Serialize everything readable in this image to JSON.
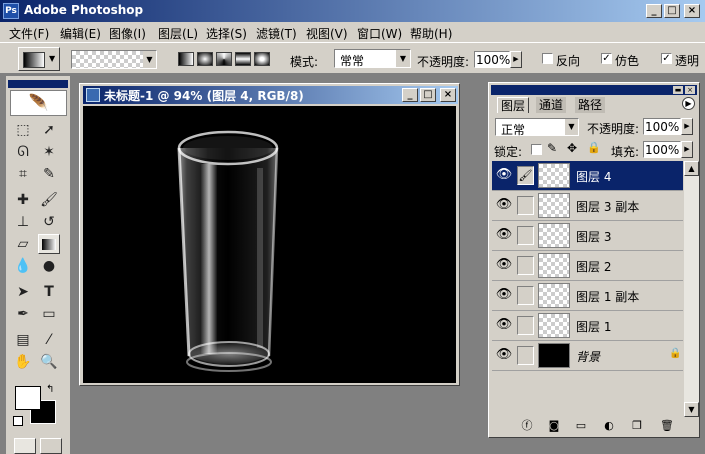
{
  "app": {
    "title": "Adobe Photoshop",
    "icon": "photoshop-logo-icon"
  },
  "window_controls": {
    "minimize": "_",
    "maximize": "□",
    "close": "×"
  },
  "menu": [
    "文件(F)",
    "编辑(E)",
    "图像(I)",
    "图层(L)",
    "选择(S)",
    "滤镜(T)",
    "视图(V)",
    "窗口(W)",
    "帮助(H)"
  ],
  "options": {
    "mode_label": "模式:",
    "mode_value": "常常",
    "opacity_label": "不透明度:",
    "opacity_value": "100%",
    "reverse_label": "反向",
    "dither_label": "仿色",
    "transparency_label": "透明",
    "reverse_checked": false,
    "dither_checked": true,
    "transparency_checked": true
  },
  "document": {
    "title": "未标题-1 @ 94% (图层 4, RGB/8)"
  },
  "layers_panel": {
    "tabs": [
      "图层",
      "通道",
      "路径"
    ],
    "blend_mode": "正常",
    "opacity_label": "不透明度:",
    "opacity_value": "100%",
    "lock_label": "锁定:",
    "fill_label": "填充:",
    "fill_value": "100%",
    "layers": [
      {
        "name": "图层 4",
        "selected": true,
        "thumb": "transparent"
      },
      {
        "name": "图层 3 副本",
        "selected": false,
        "thumb": "transparent"
      },
      {
        "name": "图层 3",
        "selected": false,
        "thumb": "transparent"
      },
      {
        "name": "图层 2",
        "selected": false,
        "thumb": "transparent"
      },
      {
        "name": "图层 1 副本",
        "selected": false,
        "thumb": "transparent"
      },
      {
        "name": "图层 1",
        "selected": false,
        "thumb": "transparent"
      },
      {
        "name": "背景",
        "selected": false,
        "thumb": "black",
        "locked": true
      }
    ],
    "bottom_icons": [
      "layer-style-icon",
      "mask-icon",
      "group-icon",
      "adjustment-layer-icon",
      "new-layer-icon",
      "trash-icon"
    ]
  },
  "colors": {
    "titlebar": "#0a246a",
    "selection": "#0a246a",
    "chrome": "#d4d0c8",
    "workspace": "#808080"
  }
}
